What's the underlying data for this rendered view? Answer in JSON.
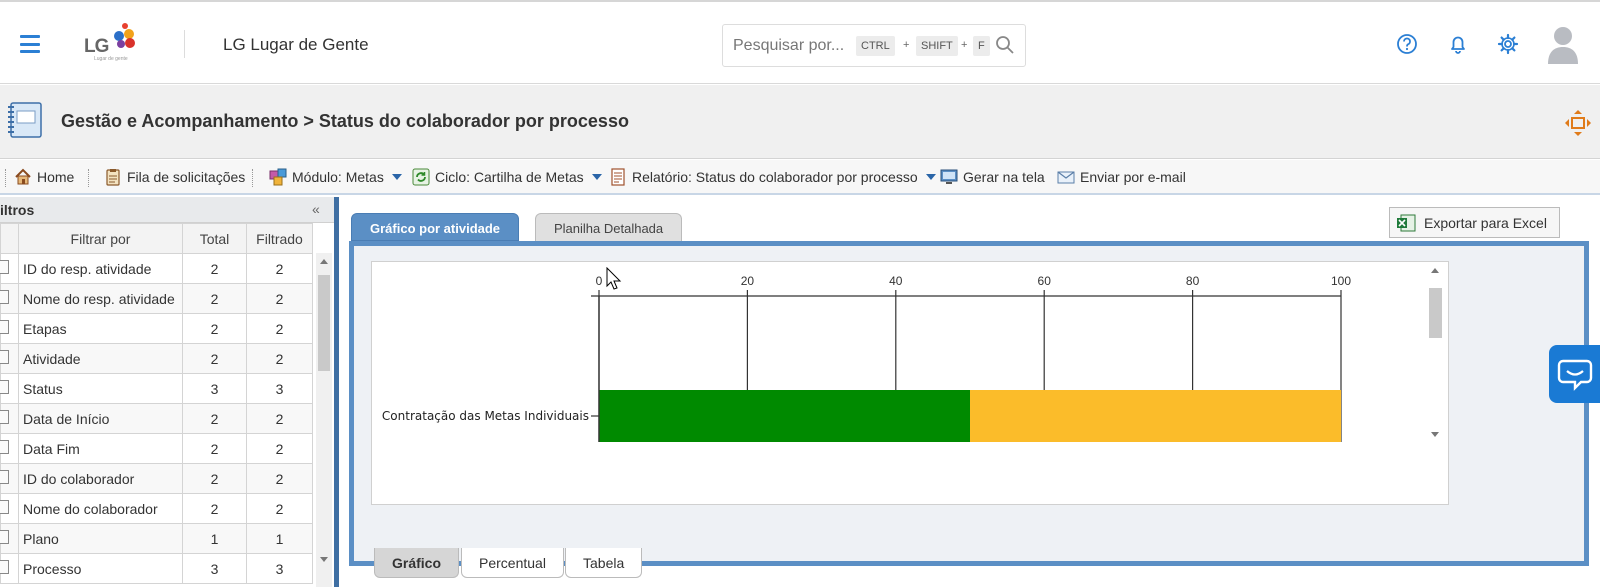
{
  "header": {
    "app_title": "LG Lugar de Gente",
    "logo_text": "LG",
    "logo_subtext": "Lugar de gente",
    "search_placeholder": "Pesquisar por...",
    "shortcut_keys": [
      "CTRL",
      "SHIFT",
      "F"
    ],
    "shortcut_joiner": "+"
  },
  "breadcrumb": {
    "text": "Gestão e Acompanhamento > Status do colaborador por processo"
  },
  "toolbar": {
    "home": "Home",
    "queue": "Fila de solicitações",
    "module": "Módulo: Metas",
    "cycle": "Ciclo: Cartilha de Metas",
    "report": "Relatório: Status do colaborador por processo",
    "generate": "Gerar na tela",
    "email": "Enviar por e-mail"
  },
  "filters": {
    "title": "iltros",
    "columns": [
      "Filtrar por",
      "Total",
      "Filtrado"
    ],
    "rows": [
      {
        "name": "ID do resp. atividade",
        "total": "2",
        "filtered": "2"
      },
      {
        "name": "Nome do resp. atividade",
        "total": "2",
        "filtered": "2"
      },
      {
        "name": "Etapas",
        "total": "2",
        "filtered": "2"
      },
      {
        "name": "Atividade",
        "total": "2",
        "filtered": "2"
      },
      {
        "name": "Status",
        "total": "3",
        "filtered": "3"
      },
      {
        "name": "Data de Início",
        "total": "2",
        "filtered": "2"
      },
      {
        "name": "Data Fim",
        "total": "2",
        "filtered": "2"
      },
      {
        "name": "ID do colaborador",
        "total": "2",
        "filtered": "2"
      },
      {
        "name": "Nome do colaborador",
        "total": "2",
        "filtered": "2"
      },
      {
        "name": "Plano",
        "total": "1",
        "filtered": "1"
      },
      {
        "name": "Processo",
        "total": "3",
        "filtered": "3"
      }
    ]
  },
  "main": {
    "tabs": [
      "Gráfico por atividade",
      "Planilha Detalhada"
    ],
    "export_label": "Exportar para Excel",
    "subtabs": [
      "Gráfico",
      "Percentual",
      "Tabela"
    ]
  },
  "colors": {
    "accent": "#5b8fc5",
    "green": "#008a00",
    "yellow": "#fbbc2a",
    "icon_blue": "#2b7fd4"
  },
  "chart_data": {
    "type": "bar",
    "orientation": "horizontal",
    "stacked": true,
    "categories": [
      "Contratação das Metas Individuais"
    ],
    "series": [
      {
        "values": [
          50
        ],
        "color": "#008a00"
      },
      {
        "values": [
          50
        ],
        "color": "#fbbc2a"
      }
    ],
    "xlim": [
      0,
      100
    ],
    "xticks": [
      0,
      20,
      40,
      60,
      80,
      100
    ],
    "axis_position": "top",
    "grid": true
  }
}
